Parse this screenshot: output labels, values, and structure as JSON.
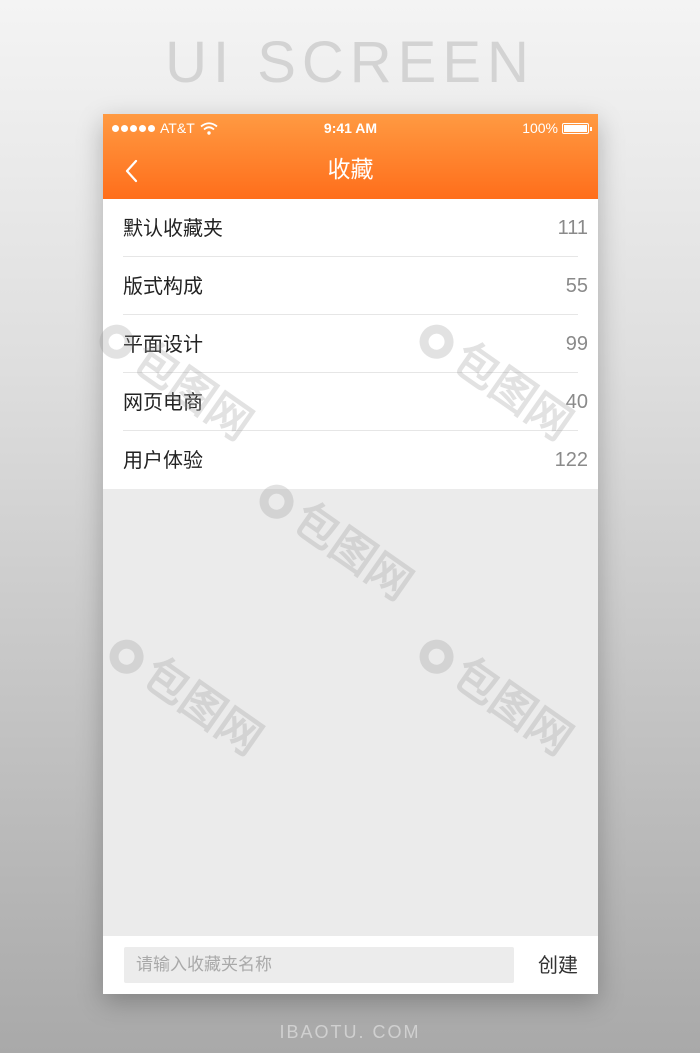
{
  "page_heading": "UI SCREEN",
  "status_bar": {
    "carrier": "AT&T",
    "time": "9:41 AM",
    "battery": "100%"
  },
  "navbar": {
    "title": "收藏",
    "back_icon": "chevron-left-icon"
  },
  "folders": [
    {
      "label": "默认收藏夹",
      "count": "111"
    },
    {
      "label": "版式构成",
      "count": "55"
    },
    {
      "label": "平面设计",
      "count": "99"
    },
    {
      "label": "网页电商",
      "count": "40"
    },
    {
      "label": "用户体验",
      "count": "122"
    }
  ],
  "footer": {
    "input_placeholder": "请输入收藏夹名称",
    "input_value": "",
    "create_label": "创建"
  },
  "watermark_text": "包图网",
  "bottom_caption": "IBAOTU. COM",
  "colors": {
    "accent_top": "#ff9a42",
    "accent_bottom": "#ff6e1b",
    "background": "#ebebeb"
  }
}
